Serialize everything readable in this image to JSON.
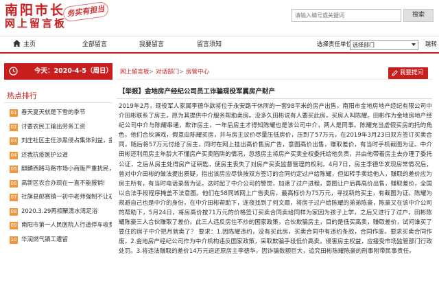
{
  "header": {
    "title": "南阳市长",
    "subtitle": "网上留言板",
    "slogan": "务实有担当",
    "search_placeholder": "请输入编号或关键词",
    "search_button": "搜索"
  },
  "nav": {
    "home": "主页",
    "all_messages": "全部留言",
    "my_messages": "我要留言",
    "guide": "留言须知",
    "dept_label": "选择责任单位：",
    "dept_selected": "选择部门",
    "jump": "跳转"
  },
  "sidebar": {
    "date": "今天：2020-4-5（周日）",
    "hot_title": "热点排行",
    "hot_items": [
      {
        "num": "01",
        "text": "春天夏天就是下雪的季节"
      },
      {
        "num": "02",
        "text": "讨要农民工输出劳务工资"
      },
      {
        "num": "03",
        "text": "刘庄社区主任涉黑侵占集体利益，损坏"
      },
      {
        "num": "04",
        "text": "还我抗疫医护公道"
      },
      {
        "num": "05",
        "text": "麒麟西路马路市场小商贩严重扰民，影"
      },
      {
        "num": "06",
        "text": "高新区农合办现在一直不能报销!"
      },
      {
        "num": "07",
        "text": "社旗县邮赛镇一初中老师强制不让初三"
      },
      {
        "num": "08",
        "text": "2020.3.29再相聚清水湾足浴"
      },
      {
        "num": "09",
        "text": "南阳市第一人民医院人行道停车收费合"
      },
      {
        "num": "10",
        "text": "华润燃气镇工遭留"
      }
    ]
  },
  "main": {
    "breadcrumb": [
      "网上留言板",
      "对话部门",
      "房管中心"
    ],
    "breadcrumb_sep": ">",
    "ask_button": "我要提问",
    "title": "【举报】金地房产经纪公司员工诈骗现役军属房产财产",
    "body": "2019年2月，现役军人家属李德华欲将位于永安路干休所的一套98平米的房产出售。南阳市金地房地产经纪有限公司中介田彬联系了房主，愿为其提供中介服务帮助卖房。没多久田彬说有人要买此房，买房人叫陈耀。田彬作为金地房地产经纪公司中介与陈耀串通，欺诈房主，一年后房主才得知陈耀也是该公司中介，两人是同事。陈耀充当虚假买房的托的角色，他们合伙演戏，假意由陈耀买房，并与房主议价尽量压低房价，压到了57万元，在2019年3月23日双方签订买卖合同，随后将57万元付给了房主，同时在网上挂出高价售房广告，意图高价出售，赚取差价，有当时手机截图为证。中介田彬还利用房主年龄大不懂房产买卖陷阱的情况，忽悠房主将房产买卖全权委托给他负责，并由他带着房主去办理了委托公证，之后从房主处得房产证钥匙，使房主丧失了对房产买卖监督管理的权利。4月7日，房主李德华发现房常情况后，曾对中介田彬的做法提出质疑，指出该房应尽快按双方签订的合同约定过户给陈耀，但如转手卖给他人，赚取的差价应为房主所有，有当时电话录音为证。这时起了中介公司的警觉，加速了过户进程，意图让户后再高价出售，赚取差价，全国以合法手段程序掩盖不法意图。他们在58同城网上广告卖房，最高标价为75万元，寻找新的买主，有截图为证。陈耀为规避自己也是中介的身份，在中介田彬帮助下，连夜找到了何文霞，将房子过户给陈耀的弟弟陈豪，陈豪又在该中介公司的帮助下，5月24日，将房高价按71万元的价格签订买卖合同卖给同样为家因为孩子上学，之后又进行了过户，田彬陈耀陈豪三人合伙赚取了差价。此三人违反房住不炒的国家政策，合伙欺骗房主，目的是低买高卖，赚取差价，试问谁买了要住的房子中介把月就卖了？ 要求：1.因陈耀违约，没有买此房，买卖合同中有违约条款，合同作废。要求买卖合同作废，2.金地房产经纪公司作为中介机构违反国家政策，采取欺骗手段低价高卖，侵害房主权益，应接受市场监管部门行政处罚。3.将违法赚取的差价14万元退还原房主李德华，因诈骗数额巨大，追究田彬陈耀陈豪的刑事附带民事责任。"
  },
  "colors": {
    "brand_red": "#c81e1e",
    "hot_badge": "#f0963c"
  }
}
